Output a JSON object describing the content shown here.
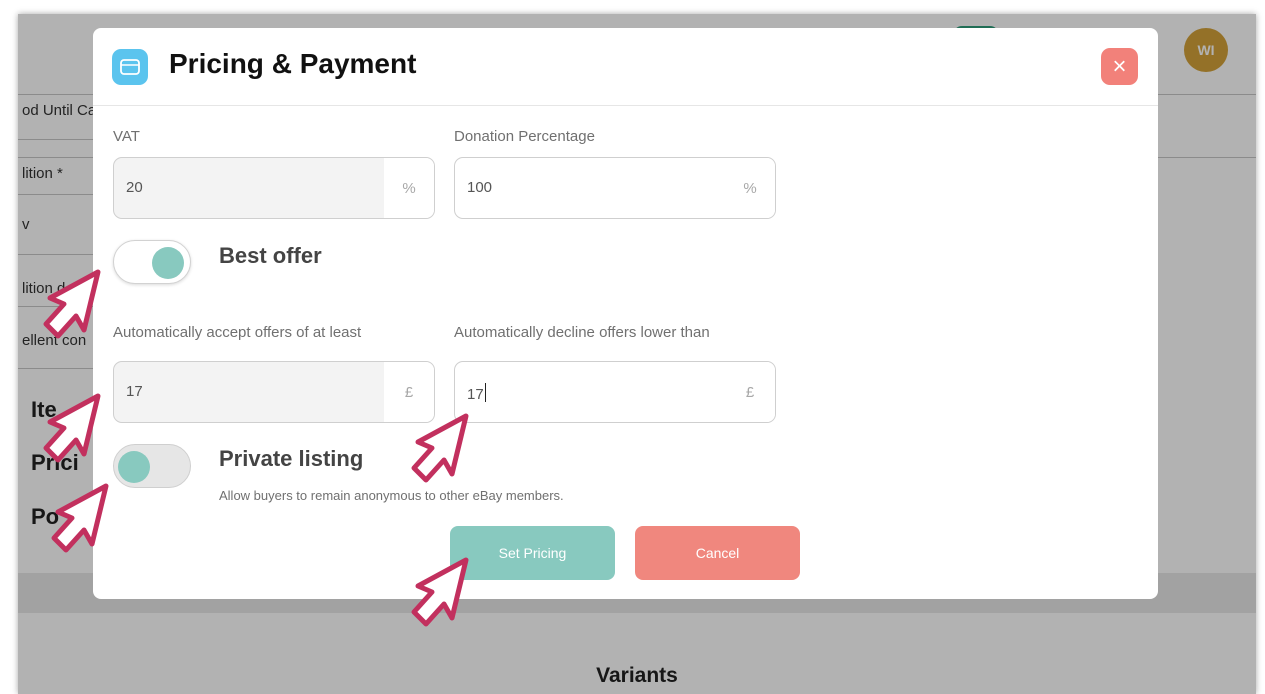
{
  "background": {
    "rows": [
      "od Until Ca",
      "lition *",
      "v",
      "lition d",
      "ellent con"
    ],
    "headings": [
      "Ite",
      "Prici",
      "Po"
    ],
    "avatar_initials": "WI",
    "variants_title": "Variants"
  },
  "modal": {
    "title": "Pricing & Payment",
    "icon": "card-icon",
    "close_icon": "close-icon",
    "close_symbol": "×",
    "vat": {
      "label": "VAT",
      "value": "20",
      "unit": "%"
    },
    "donation": {
      "label": "Donation Percentage",
      "value": "100",
      "unit": "%"
    },
    "best_offer": {
      "label": "Best offer",
      "enabled": true
    },
    "accept_offers": {
      "label": "Automatically accept offers of at least",
      "value": "17",
      "unit": "£"
    },
    "decline_offers": {
      "label": "Automatically decline offers lower than",
      "value": "17",
      "unit": "£"
    },
    "private_listing": {
      "label": "Private listing",
      "description": "Allow buyers to remain anonymous to other eBay members.",
      "enabled": false
    },
    "set_pricing_label": "Set Pricing",
    "cancel_label": "Cancel"
  },
  "colors": {
    "accent_teal": "#88c9bf",
    "cancel_red": "#f0877e",
    "close_red": "#f2817a",
    "header_icon_blue": "#5bc4ee",
    "cursor_pink": "#c2305e"
  }
}
